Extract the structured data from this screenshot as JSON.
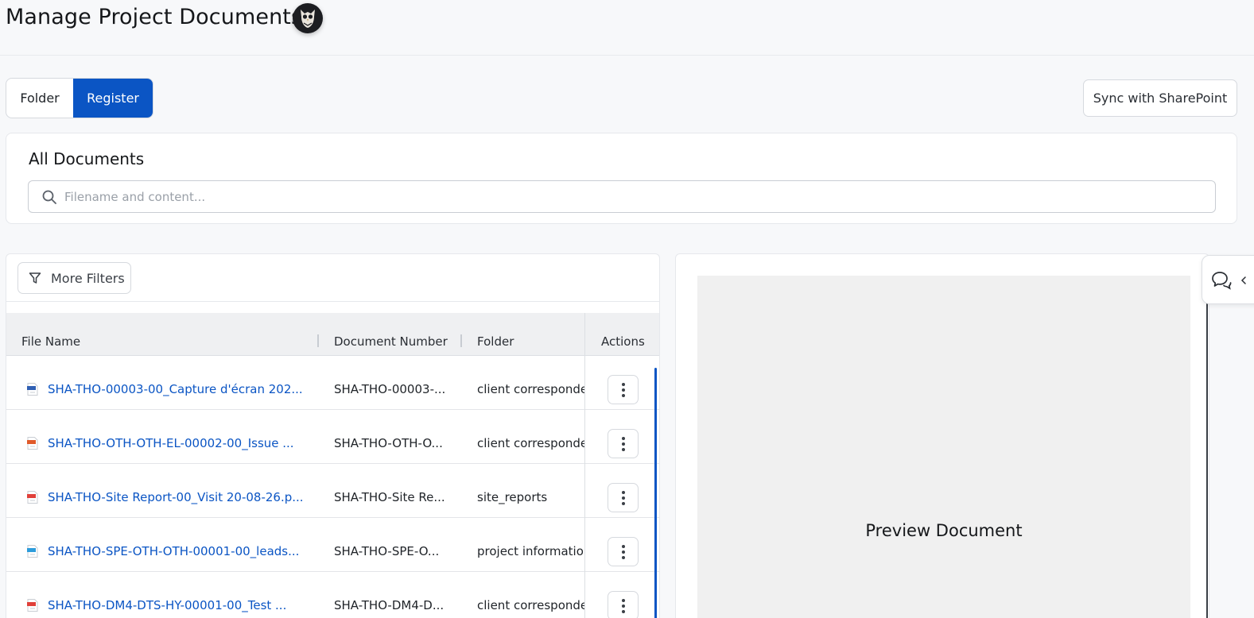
{
  "header": {
    "title": "Manage Project Documents"
  },
  "view_toggle": {
    "folder_label": "Folder",
    "register_label": "Register",
    "selected": "Register"
  },
  "sync_button": {
    "label": "Sync with SharePoint"
  },
  "search_card": {
    "title": "All Documents",
    "placeholder": "Filename and content..."
  },
  "filters": {
    "more_filters_label": "More Filters"
  },
  "table": {
    "headers": {
      "file_name": "File Name",
      "document_number": "Document Number",
      "folder": "Folder",
      "actions": "Actions"
    },
    "rows": [
      {
        "file_name": "SHA-THO-00003-00_Capture d'écran 202...",
        "document_number": "SHA-THO-00003-...",
        "folder": "client corresponde...",
        "icon": "png-file-icon"
      },
      {
        "file_name": "SHA-THO-OTH-OTH-EL-00002-00_Issue ...",
        "document_number": "SHA-THO-OTH-O...",
        "folder": "client corresponde...",
        "icon": "zip-file-icon"
      },
      {
        "file_name": "SHA-THO-Site Report-00_Visit 20-08-26.p...",
        "document_number": "SHA-THO-Site Re...",
        "folder": "site_reports",
        "icon": "pdf-file-icon"
      },
      {
        "file_name": "SHA-THO-SPE-OTH-OTH-00001-00_leads...",
        "document_number": "SHA-THO-SPE-O...",
        "folder": "project information",
        "icon": "csv-file-icon"
      },
      {
        "file_name": "SHA-THO-DM4-DTS-HY-00001-00_Test ...",
        "document_number": "SHA-THO-DM4-D...",
        "folder": "client corresponde...",
        "icon": "pdf-file-icon"
      }
    ]
  },
  "preview": {
    "label": "Preview Document"
  },
  "colors": {
    "accent": "#0b55c4",
    "background": "#f7f8fa",
    "preview_bg": "#f0f0f0"
  }
}
